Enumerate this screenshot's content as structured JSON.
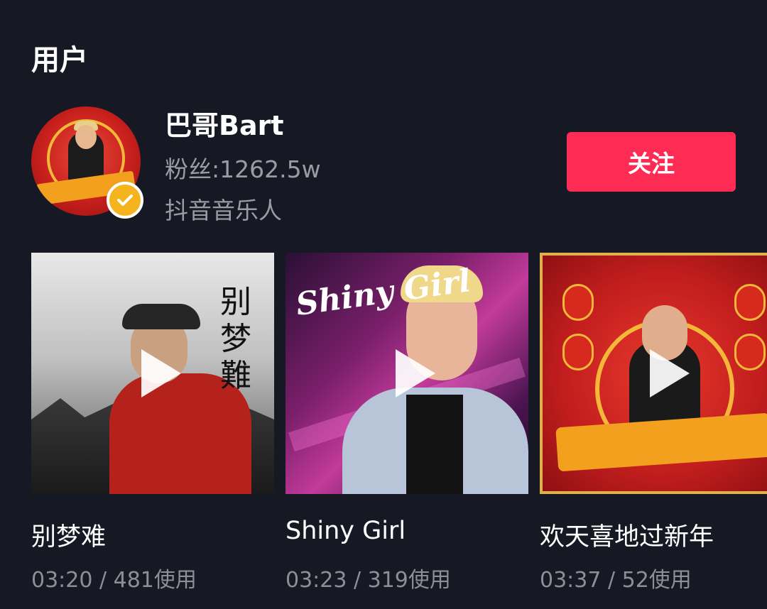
{
  "section": {
    "title": "用户"
  },
  "user": {
    "name": "巴哥Bart",
    "followers": "粉丝:1262.5w",
    "role": "抖音音乐人",
    "follow_label": "关注",
    "avatar_icon": "avatar-image",
    "verified_icon": "verified-check-icon"
  },
  "colors": {
    "background": "#161924",
    "follow_button": "#fe2c55",
    "verified_badge": "#f5b41e",
    "secondary_text": "#9a9ca3"
  },
  "songs": [
    {
      "title": "别梦难",
      "meta": "03:20 / 481使用",
      "cover_text": "别梦難",
      "play_icon": "play-icon"
    },
    {
      "title": "Shiny Girl",
      "meta": "03:23 / 319使用",
      "cover_text": "Shiny Girl",
      "play_icon": "play-icon"
    },
    {
      "title": "欢天喜地过新年",
      "meta": "03:37 / 52使用",
      "cover_text": "",
      "play_icon": "play-icon"
    }
  ]
}
